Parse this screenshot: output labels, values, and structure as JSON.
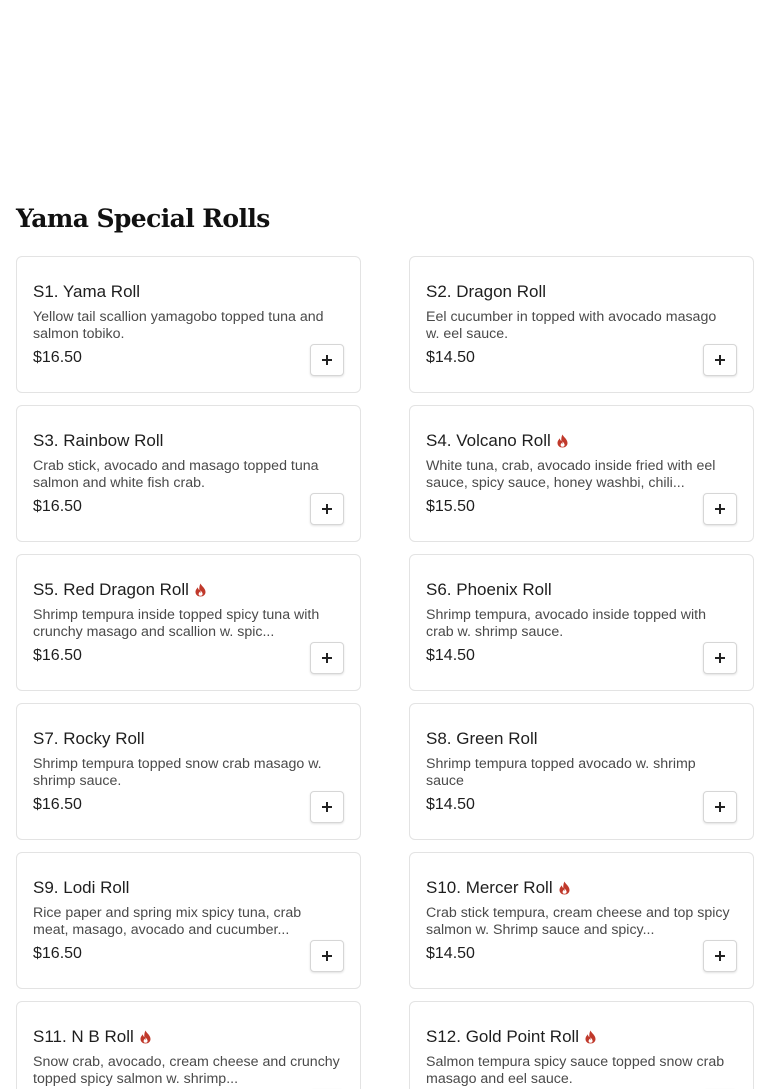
{
  "section": {
    "title": "Yama Special Rolls"
  },
  "colors": {
    "spicy": "#c0392b",
    "border": "#e3e3e3"
  },
  "icons": {
    "spicy": "flame-icon",
    "add": "plus-icon"
  },
  "items": [
    {
      "name": "S1. Yama Roll",
      "spicy": false,
      "desc": "Yellow tail scallion yamagobo topped tuna and salmon tobiko.",
      "price": "$16.50"
    },
    {
      "name": "S2. Dragon Roll",
      "spicy": false,
      "desc": "Eel cucumber in topped with avocado masago w. eel sauce.",
      "price": "$14.50"
    },
    {
      "name": "S3. Rainbow Roll",
      "spicy": false,
      "desc": "Crab stick, avocado and masago topped tuna salmon and white fish crab.",
      "price": "$16.50"
    },
    {
      "name": "S4. Volcano Roll",
      "spicy": true,
      "desc": "White tuna, crab, avocado inside fried with eel sauce, spicy sauce, honey washbi, chili...",
      "price": "$15.50"
    },
    {
      "name": "S5. Red Dragon Roll",
      "spicy": true,
      "desc": "Shrimp tempura inside topped spicy tuna with crunchy masago and scallion w. spic...",
      "price": "$16.50"
    },
    {
      "name": "S6. Phoenix Roll",
      "spicy": false,
      "desc": "Shrimp tempura, avocado inside topped with crab w. shrimp sauce.",
      "price": "$14.50"
    },
    {
      "name": "S7. Rocky Roll",
      "spicy": false,
      "desc": "Shrimp tempura topped snow crab masago w. shrimp sauce.",
      "price": "$16.50"
    },
    {
      "name": "S8. Green Roll",
      "spicy": false,
      "desc": "Shrimp tempura topped avocado w. shrimp sauce",
      "price": "$14.50"
    },
    {
      "name": "S9. Lodi Roll",
      "spicy": false,
      "desc": "Rice paper and spring mix spicy tuna, crab meat, masago, avocado and cucumber...",
      "price": "$16.50"
    },
    {
      "name": "S10. Mercer Roll",
      "spicy": true,
      "desc": "Crab stick tempura, cream cheese and top spicy salmon w. Shrimp sauce and spicy...",
      "price": "$14.50"
    },
    {
      "name": "S11. N B Roll",
      "spicy": true,
      "desc": "Snow crab, avocado, cream cheese and crunchy topped spicy salmon w. shrimp...",
      "price": ""
    },
    {
      "name": "S12. Gold Point Roll",
      "spicy": true,
      "desc": "Salmon tempura spicy sauce topped snow crab masago and eel sauce.",
      "price": ""
    }
  ]
}
